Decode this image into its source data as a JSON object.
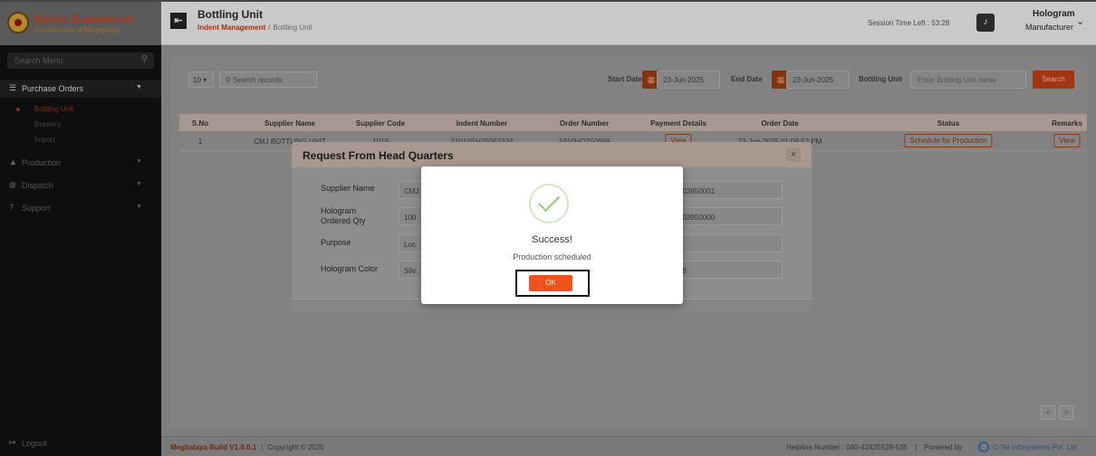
{
  "header": {
    "brand_title": "Excise Department",
    "brand_subtitle": "Government of Meghalaya",
    "module_title": "Bottling Unit",
    "breadcrumb": [
      "Indent Management",
      "/",
      "Bottling Unit"
    ],
    "session_text": "Session Time Left : 53:28",
    "user_name": "Hologram",
    "user_role": "Manufacturer"
  },
  "sidebar": {
    "search_placeholder": "Search Menu",
    "purchase_orders": "Purchase Orders",
    "sub_items": [
      "Bottling Unit",
      "Brewery",
      "Import"
    ],
    "items": [
      "Production",
      "Dispatch",
      "Support"
    ],
    "logout": "Logout"
  },
  "filters": {
    "page_size": "10",
    "search_placeholder": "Search records",
    "start_date_label": "Start Date",
    "start_date": "23-Jun-2025",
    "end_date_label": "End Date",
    "end_date": "23-Jun-2025",
    "bottling_unit_label": "Bottling Unit",
    "bottling_unit_placeholder": "Enter Bottling Unit name",
    "search_button": "Search"
  },
  "table": {
    "columns": [
      "S.No",
      "Supplier Name",
      "Supplier Code",
      "Indent Number",
      "Order Number",
      "Payment Details",
      "Order Date",
      "Status",
      "Remarks"
    ],
    "rows": [
      {
        "sno": "1",
        "supplier_name": "CMJ BOTTLING UNIT",
        "supplier_code": "1010",
        "indent_number": "21010SH25062324",
        "order_number": "1010HO250669",
        "payment": "View",
        "order_date": "23-Jun-2025 01:09:52 PM",
        "status": "Schedule for Production",
        "remarks": "View"
      }
    ]
  },
  "request_modal": {
    "title": "Request From Head Quarters",
    "close": "×",
    "fields": [
      {
        "label": "Supplier Name",
        "value": "CMJ"
      },
      {
        "label": "Hologram Ordered Qty",
        "value": "100"
      },
      {
        "label": "Purpose",
        "value": "Loc"
      },
      {
        "label": "Hologram Color",
        "value": "Silv"
      }
    ],
    "right_values": [
      "003850001",
      "003950000",
      "4",
      "25"
    ]
  },
  "success_dialog": {
    "title": "Success!",
    "message": "Production scheduled",
    "ok": "OK"
  },
  "pager": {
    "prev": "<",
    "next": ">"
  },
  "footer": {
    "build": "Meghalaya Build V1.0.0.1",
    "separator": "|",
    "copyright": "Copyright © 2025",
    "helpline": "Helpline Number : 040-42425528-535",
    "powered_by": "Powered by",
    "company": "C-Tel Infosystems Pvt. Ltd."
  }
}
